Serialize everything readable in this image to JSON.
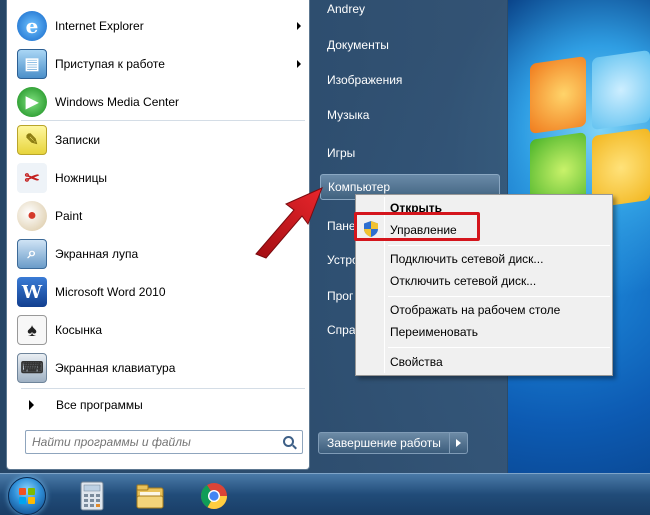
{
  "start_menu": {
    "programs": [
      {
        "label": "Internet Explorer",
        "icon": "internet-explorer-icon",
        "has_submenu": true
      },
      {
        "label": "Приступая к работе",
        "icon": "getting-started-icon",
        "has_submenu": true
      },
      {
        "label": "Windows Media Center",
        "icon": "media-center-icon",
        "has_submenu": false
      },
      {
        "label": "Записки",
        "icon": "sticky-notes-icon",
        "has_submenu": false
      },
      {
        "label": "Ножницы",
        "icon": "scissors-icon",
        "has_submenu": false
      },
      {
        "label": "Paint",
        "icon": "paint-icon",
        "has_submenu": false
      },
      {
        "label": "Экранная лупа",
        "icon": "magnifier-icon",
        "has_submenu": false
      },
      {
        "label": "Microsoft Word 2010",
        "icon": "word-icon",
        "has_submenu": false
      },
      {
        "label": "Косынка",
        "icon": "solitaire-icon",
        "has_submenu": false
      },
      {
        "label": "Экранная клавиатура",
        "icon": "keyboard-icon",
        "has_submenu": false
      }
    ],
    "all_programs": "Все программы",
    "search_placeholder": "Найти программы и файлы",
    "right_items": [
      {
        "label": "Andrey"
      },
      {
        "label": "Документы"
      },
      {
        "label": "Изображения"
      },
      {
        "label": "Музыка"
      },
      {
        "label": "Игры"
      },
      {
        "label": "Компьютер"
      },
      {
        "label": "Пане"
      },
      {
        "label": "Устро"
      },
      {
        "label": "Прог"
      },
      {
        "label": "Спра"
      }
    ],
    "shutdown_label": "Завершение работы"
  },
  "context_menu": {
    "items": [
      {
        "label": "Открыть",
        "bold": true
      },
      {
        "label": "Управление",
        "bold": false
      },
      {
        "label": "Подключить сетевой диск...",
        "bold": false
      },
      {
        "label": "Отключить сетевой диск...",
        "bold": false
      },
      {
        "label": "Отображать на рабочем столе",
        "bold": false
      },
      {
        "label": "Переименовать",
        "bold": false
      },
      {
        "label": "Свойства",
        "bold": false
      }
    ],
    "highlight_color": "#d4151c"
  },
  "taskbar": {
    "icons": [
      "start-orb-icon",
      "calculator-icon",
      "explorer-folder-icon",
      "chrome-icon"
    ]
  },
  "colors": {
    "annotation_arrow": "#d4151c"
  }
}
